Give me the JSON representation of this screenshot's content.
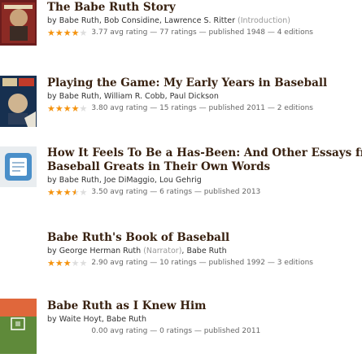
{
  "books": [
    {
      "title": "The Babe Ruth Story",
      "authors": [
        {
          "name": "Babe Ruth",
          "role": ""
        },
        {
          "name": "Bob Considine",
          "role": ""
        },
        {
          "name": "Lawrence S. Ritter",
          "role": "(Introduction)"
        }
      ],
      "rating": 3.77,
      "meta": "3.77 avg rating — 77 ratings — published 1948 — 4 editions"
    },
    {
      "title": "Playing the Game: My Early Years in Baseball",
      "authors": [
        {
          "name": "Babe Ruth",
          "role": ""
        },
        {
          "name": "William R. Cobb",
          "role": ""
        },
        {
          "name": "Paul Dickson",
          "role": ""
        }
      ],
      "rating": 3.8,
      "meta": "3.80 avg rating — 15 ratings — published 2011 — 2 editions"
    },
    {
      "title_line1": "How It Feels To Be a Has-Been: And Other Essays fro",
      "title_line2": "Baseball Greats in Their Own Words",
      "authors": [
        {
          "name": "Babe Ruth",
          "role": ""
        },
        {
          "name": "Joe DiMaggio",
          "role": ""
        },
        {
          "name": "Lou Gehrig",
          "role": ""
        }
      ],
      "rating": 3.5,
      "meta": "3.50 avg rating — 6 ratings — published 2013"
    },
    {
      "title": "Babe Ruth's Book of Baseball",
      "authors": [
        {
          "name": "George Herman Ruth",
          "role": "(Narrator)"
        },
        {
          "name": "Babe Ruth",
          "role": ""
        }
      ],
      "rating": 2.9,
      "meta": "2.90 avg rating — 10 ratings — published 1992 — 3 editions"
    },
    {
      "title": "Babe Ruth as I Knew Him",
      "authors": [
        {
          "name": "Waite Hoyt",
          "role": ""
        },
        {
          "name": "Babe Ruth",
          "role": ""
        }
      ],
      "rating": 0,
      "meta": "0.00 avg rating — 0 ratings — published 2011"
    }
  ],
  "by_label": "by"
}
